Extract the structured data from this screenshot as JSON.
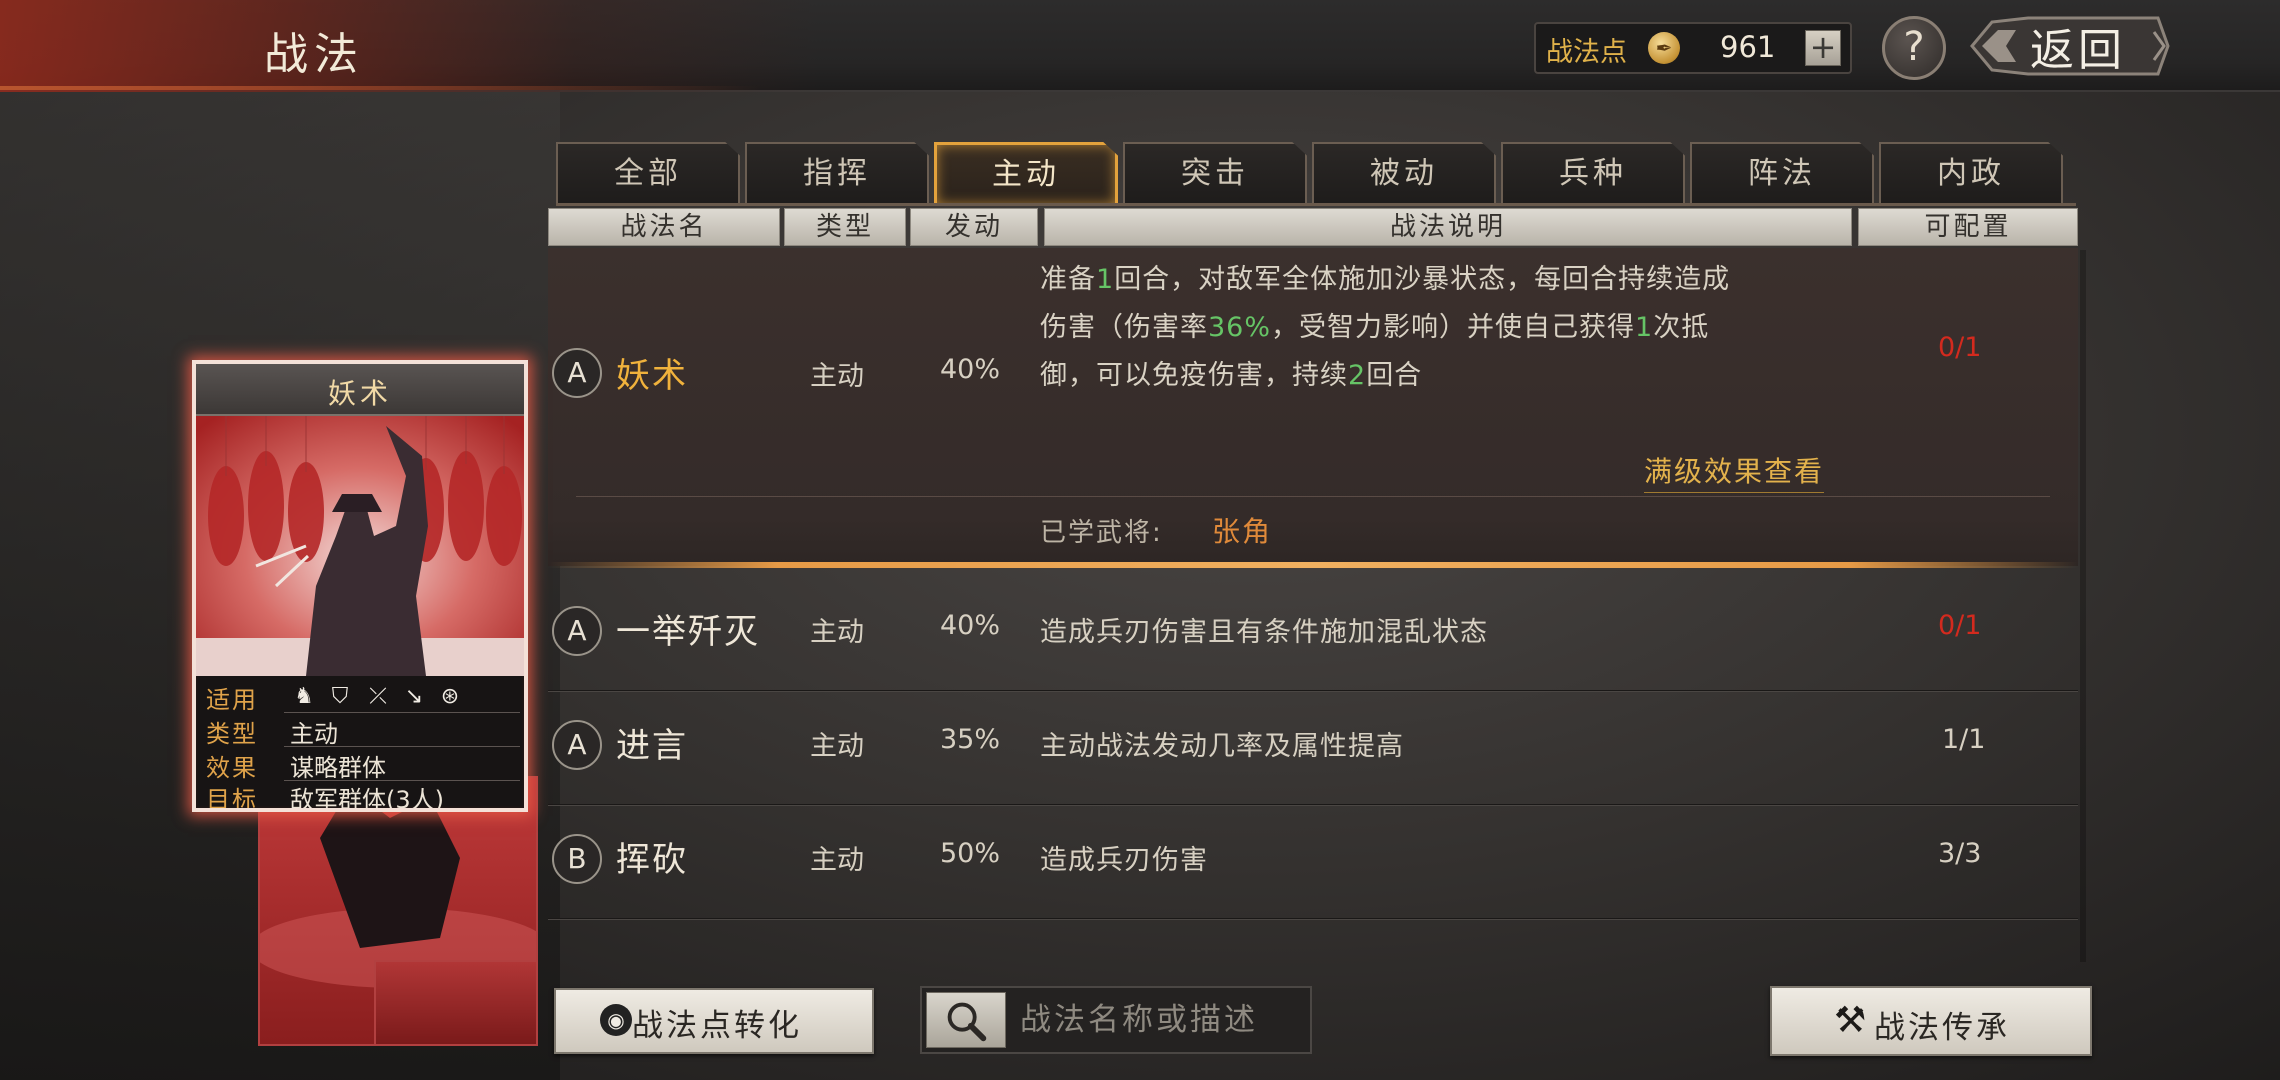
{
  "header": {
    "title": "战法",
    "points_label": "战法点",
    "points_icon": "feather-coin-icon",
    "points_value": "961",
    "plus_label": "+",
    "help_label": "?",
    "back_label": "返回"
  },
  "tabs": [
    {
      "label": "全部"
    },
    {
      "label": "指挥"
    },
    {
      "label": "主动",
      "active": true
    },
    {
      "label": "突击"
    },
    {
      "label": "被动"
    },
    {
      "label": "兵种"
    },
    {
      "label": "阵法"
    },
    {
      "label": "内政"
    }
  ],
  "columns": {
    "name": "战法名",
    "type": "类型",
    "rate": "发动",
    "desc": "战法说明",
    "config": "可配置"
  },
  "selected": {
    "grade": "A",
    "name": "妖术",
    "type": "主动",
    "rate": "40%",
    "desc": {
      "l1a": "准备",
      "l1n": "1",
      "l1b": "回合，对敌军全体施加沙暴状态，每回合持续造成",
      "l2a": "伤害（伤害率",
      "l2n": "36%",
      "l2b": "，受智力影响）并使自己获得",
      "l2n2": "1",
      "l2c": "次抵",
      "l3a": "御，可以免疫伤害，持续",
      "l3n": "2",
      "l3b": "回合"
    },
    "config": "0/1",
    "maxlevel_link": "满级效果查看",
    "learned_label": "已学武将:",
    "learned_general": "张角"
  },
  "rows": [
    {
      "grade": "A",
      "name": "一举歼灭",
      "type": "主动",
      "rate": "40%",
      "desc": "造成兵刃伤害且有条件施加混乱状态",
      "config": "0/1",
      "config_red": true
    },
    {
      "grade": "A",
      "name": "进言",
      "type": "主动",
      "rate": "35%",
      "desc": "主动战法发动几率及属性提高",
      "config": "1/1",
      "config_red": false
    },
    {
      "grade": "B",
      "name": "挥砍",
      "type": "主动",
      "rate": "50%",
      "desc": "造成兵刃伤害",
      "config": "3/3",
      "config_red": false
    }
  ],
  "card": {
    "title": "妖术",
    "apply_label": "适用",
    "unit_icons": [
      "cavalry-icon",
      "shield-icon",
      "bow-icon",
      "spear-icon",
      "wheel-icon"
    ],
    "type_label": "类型",
    "type_value": "主动",
    "effect_label": "效果",
    "effect_value": "谋略群体",
    "target_label": "目标",
    "target_value": "敌军群体(3人)"
  },
  "footer": {
    "convert_label": "战法点转化",
    "convert_icon": "swirl-icon",
    "search_icon": "magnifier-icon",
    "search_placeholder": "战法名称或描述",
    "inherit_label": "战法传承",
    "inherit_icon": "hammer-icon"
  },
  "colors": {
    "accent_gold": "#e3a23c",
    "highlight_name": "#f0b23c",
    "number_green": "#66c466",
    "config_red": "#d32a1e",
    "card_glow": "#e65a46"
  }
}
